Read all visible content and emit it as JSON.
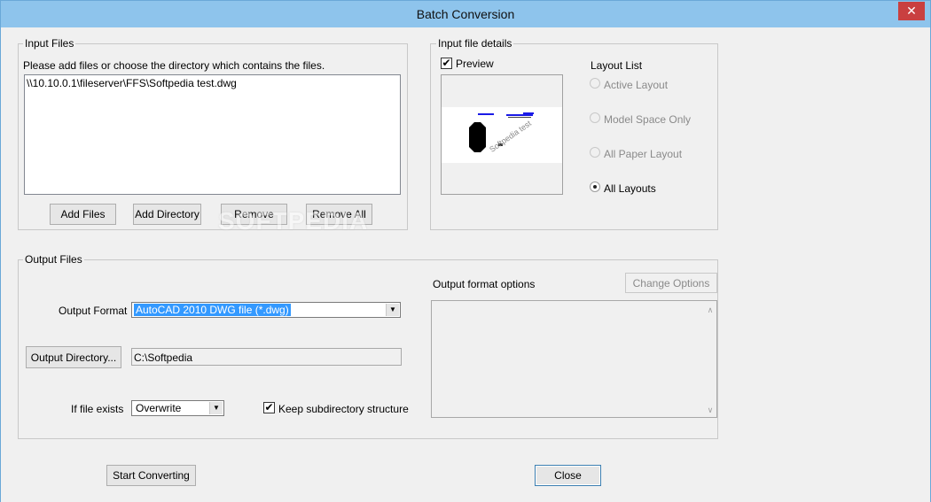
{
  "window": {
    "title": "Batch Conversion",
    "close_glyph": "✕"
  },
  "input_files": {
    "legend": "Input Files",
    "instructions": "Please add files or choose the directory which contains the files.",
    "files": [
      "\\\\10.10.0.1\\fileserver\\FFS\\Softpedia test.dwg"
    ],
    "buttons": {
      "add_files": "Add Files",
      "add_directory": "Add Directory",
      "remove": "Remove",
      "remove_all": "Remove All"
    }
  },
  "input_details": {
    "legend": "Input file details",
    "preview_label": "Preview",
    "preview_checked": true,
    "preview_text": "Softpedia test",
    "layout_list_label": "Layout List",
    "layouts": [
      {
        "label": "Active Layout",
        "enabled": false,
        "selected": false
      },
      {
        "label": "Model Space Only",
        "enabled": false,
        "selected": false
      },
      {
        "label": "All Paper Layout",
        "enabled": false,
        "selected": false
      },
      {
        "label": "All Layouts",
        "enabled": true,
        "selected": true
      }
    ]
  },
  "output_files": {
    "legend": "Output Files",
    "format_label": "Output Format",
    "format_value": "AutoCAD 2010 DWG file (*.dwg)",
    "dir_button": "Output Directory...",
    "dir_value": "C:\\Softpedia",
    "if_exists_label": "If file exists",
    "if_exists_value": "Overwrite",
    "keep_subdir_label": "Keep subdirectory structure",
    "keep_subdir_checked": true,
    "options_label": "Output format options",
    "change_options": "Change Options"
  },
  "footer": {
    "start": "Start Converting",
    "close": "Close"
  },
  "watermark": "SOFTPEDIA",
  "icons": {
    "checkmark": "✔",
    "dropdown": "▼",
    "scroll_up": "∧",
    "scroll_down": "∨"
  }
}
